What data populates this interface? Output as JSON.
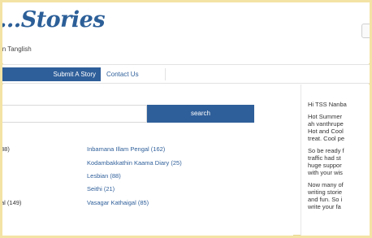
{
  "header": {
    "logo_text": "...Stories",
    "tagline": "in Tanglish"
  },
  "nav": {
    "items": [
      "Submit A Story",
      "Contact Us"
    ]
  },
  "search": {
    "button_label": "search",
    "placeholder": ""
  },
  "categories": {
    "left": [
      "38)",
      "",
      "",
      "",
      "al (149)"
    ],
    "right": [
      "Inbamana Illam Pengal (162)",
      "Kodambakkathin Kaama Diary (25)",
      "Lesbian (88)",
      "Seithi (21)",
      "Vasagar Kathaigal (85)"
    ]
  },
  "sidebar": {
    "paragraphs": [
      [
        "Hi TSS Nanba"
      ],
      [
        "Hot Summer",
        "ah vanthrupe",
        "Hot and Cool",
        "treat. Cool pe"
      ],
      [
        "So be ready f",
        "traffic had st",
        "huge suppor",
        "with your wis"
      ],
      [
        "Now many of",
        "writing storie",
        "and fun. So i",
        "write your fa"
      ]
    ]
  },
  "colors": {
    "page_border": "#f3e3a4",
    "brand_blue": "#2f5f9a"
  }
}
